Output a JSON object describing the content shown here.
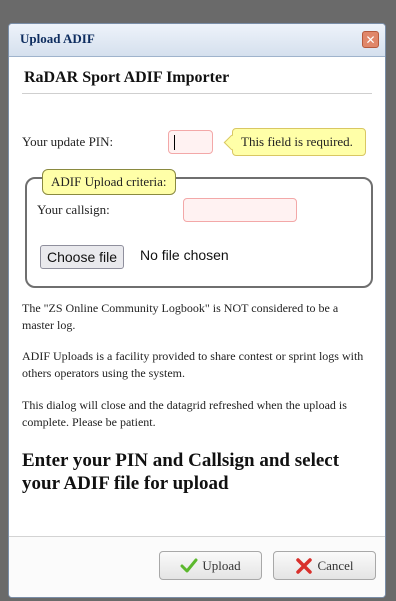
{
  "dialog": {
    "title": "Upload ADIF",
    "close_glyph": "✕",
    "heading": "RaDAR Sport ADIF Importer"
  },
  "form": {
    "pin_label": "Your update PIN:",
    "pin_value": "",
    "pin_tooltip": "This field is required.",
    "criteria_legend": "ADIF Upload criteria:",
    "callsign_label": "Your callsign:",
    "callsign_value": "",
    "file_button_label": "Choose file",
    "file_status": "No file chosen"
  },
  "info": {
    "para1": "The \"ZS Online Community Logbook\" is NOT considered to be a master log.",
    "para2": "ADIF Uploads is a facility provided to share contest or sprint logs with others operators using the system.",
    "para3": "This dialog will close and the datagrid refreshed when the upload is complete. Please be patient.",
    "instruction": "Enter your PIN and Callsign and select your ADIF file for upload"
  },
  "buttons": {
    "upload_label": "Upload",
    "upload_icon": "checkmark-icon",
    "cancel_label": "Cancel",
    "cancel_icon": "x-icon"
  },
  "colors": {
    "required_field_bg": "#fff2f2",
    "tooltip_bg": "#ffffa8",
    "upload_icon": "#5cb82e",
    "cancel_icon": "#d9302c"
  }
}
